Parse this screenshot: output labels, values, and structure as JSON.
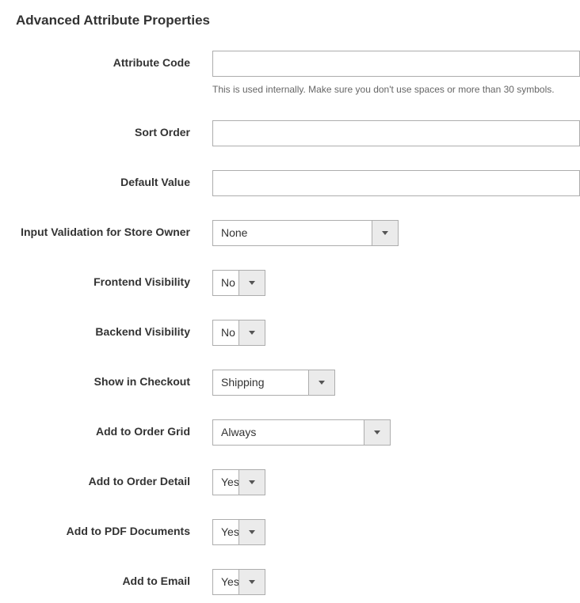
{
  "title": "Advanced Attribute Properties",
  "fields": {
    "attribute_code": {
      "label": "Attribute Code",
      "value": "",
      "hint": "This is used internally. Make sure you don't use spaces or more than 30 symbols."
    },
    "sort_order": {
      "label": "Sort Order",
      "value": ""
    },
    "default_value": {
      "label": "Default Value",
      "value": ""
    },
    "input_validation": {
      "label": "Input Validation for Store Owner",
      "value": "None"
    },
    "frontend_visibility": {
      "label": "Frontend Visibility",
      "value": "No"
    },
    "backend_visibility": {
      "label": "Backend Visibility",
      "value": "No"
    },
    "show_in_checkout": {
      "label": "Show in Checkout",
      "value": "Shipping"
    },
    "add_to_order_grid": {
      "label": "Add to Order Grid",
      "value": "Always"
    },
    "add_to_order_detail": {
      "label": "Add to Order Detail",
      "value": "Yes"
    },
    "add_to_pdf": {
      "label": "Add to PDF Documents",
      "value": "Yes"
    },
    "add_to_email": {
      "label": "Add to Email",
      "value": "Yes"
    }
  }
}
